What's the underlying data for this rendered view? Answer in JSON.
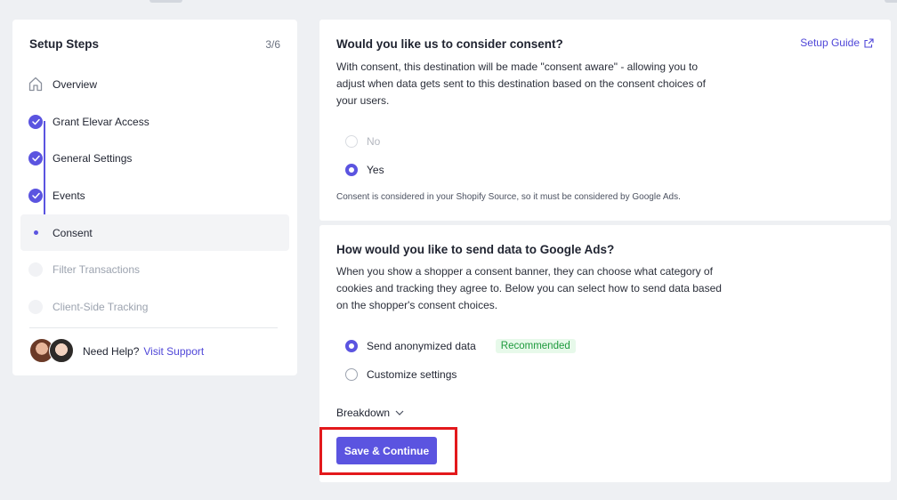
{
  "sidebar": {
    "title": "Setup Steps",
    "count": "3/6",
    "steps": [
      {
        "label": "Overview",
        "state": "home"
      },
      {
        "label": "Grant Elevar Access",
        "state": "done"
      },
      {
        "label": "General Settings",
        "state": "done"
      },
      {
        "label": "Events",
        "state": "done"
      },
      {
        "label": "Consent",
        "state": "current"
      },
      {
        "label": "Filter Transactions",
        "state": "pending"
      },
      {
        "label": "Client-Side Tracking",
        "state": "pending"
      }
    ],
    "help": {
      "text": "Need Help?",
      "link": "Visit Support"
    }
  },
  "consent_card": {
    "title": "Would you like us to consider consent?",
    "guide_link": "Setup Guide",
    "description": "With consent, this destination will be made \"consent aware\" - allowing you to adjust when data gets sent to this destination based on the consent choices of your users.",
    "options": [
      {
        "label": "No",
        "selected": false,
        "disabled": true
      },
      {
        "label": "Yes",
        "selected": true,
        "disabled": false
      }
    ],
    "note": "Consent is considered in your Shopify Source, so it must be considered by Google Ads."
  },
  "send_card": {
    "title": "How would you like to send data to Google Ads?",
    "description": "When you show a shopper a consent banner, they can choose what category of cookies and tracking they agree to. Below you can select how to send data based on the shopper's consent choices.",
    "options": [
      {
        "label": "Send anonymized data",
        "selected": true,
        "badge": "Recommended"
      },
      {
        "label": "Customize settings",
        "selected": false
      }
    ],
    "breakdown_label": "Breakdown",
    "save_label": "Save & Continue"
  },
  "colors": {
    "accent": "#5b54e0",
    "highlight": "#e3191c",
    "badge_bg": "#e7f9ea",
    "badge_text": "#1e9a3d"
  }
}
